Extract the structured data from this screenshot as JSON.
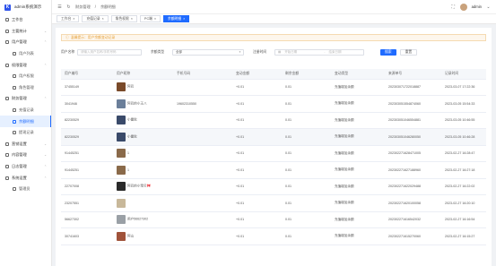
{
  "app": {
    "logo_letter": "K",
    "title": "admin系统演示"
  },
  "sidebar": {
    "items": [
      {
        "label": "工作台",
        "level": 0,
        "active": false,
        "icon": "dashboard-icon"
      },
      {
        "label": "主要统计",
        "level": 0,
        "active": false,
        "icon": "chart-icon",
        "caret": "⌄"
      },
      {
        "label": "用户管理",
        "level": 0,
        "active": false,
        "icon": "user-icon",
        "caret": "⌃"
      },
      {
        "label": "用户列表",
        "level": 1,
        "active": false,
        "icon": "list-icon"
      },
      {
        "label": "权限管理",
        "level": 0,
        "active": false,
        "icon": "lock-icon",
        "caret": "⌃"
      },
      {
        "label": "用户权限",
        "level": 1,
        "active": false,
        "icon": "key-icon"
      },
      {
        "label": "角色管理",
        "level": 1,
        "active": false,
        "icon": "role-icon"
      },
      {
        "label": "财务管理",
        "level": 0,
        "active": false,
        "icon": "wallet-icon",
        "caret": "⌃"
      },
      {
        "label": "充值记录",
        "level": 1,
        "active": false,
        "icon": "recharge-icon"
      },
      {
        "label": "余额明细",
        "level": 1,
        "active": true,
        "icon": "balance-icon"
      },
      {
        "label": "提现记录",
        "level": 1,
        "active": false,
        "icon": "withdraw-icon"
      },
      {
        "label": "营销设置",
        "level": 0,
        "active": false,
        "icon": "megaphone-icon",
        "caret": "⌄"
      },
      {
        "label": "内容管理",
        "level": 0,
        "active": false,
        "icon": "document-icon",
        "caret": "⌄"
      },
      {
        "label": "日志管理",
        "level": 0,
        "active": false,
        "icon": "log-icon",
        "caret": "⌃"
      },
      {
        "label": "系统设置",
        "level": 0,
        "active": false,
        "icon": "gear-icon",
        "caret": "⌃"
      },
      {
        "label": "管理员",
        "level": 1,
        "active": false,
        "icon": "admin-icon"
      }
    ]
  },
  "topbar": {
    "breadcrumb": [
      "财务管理",
      "/",
      "余额明细"
    ],
    "username": "admin",
    "fullscreen_icon": "⛶",
    "refresh_icon": "↻"
  },
  "tabs": [
    {
      "label": "工作台",
      "active": false
    },
    {
      "label": "充值记录",
      "active": false
    },
    {
      "label": "角色权限",
      "active": false
    },
    {
      "label": "PC端",
      "active": false
    },
    {
      "label": "余额明细",
      "active": true
    }
  ],
  "notice": {
    "icon": "ⓘ",
    "text": "温馨提示：用户余额变动记录"
  },
  "filter": {
    "user_label": "用户名称",
    "user_placeholder": "请输入用户名称/手机号码",
    "type_label": "余额类型",
    "type_value": "全部",
    "time_label": "注册时间",
    "start_placeholder": "开始日期",
    "end_placeholder": "结束日期",
    "search_label": "搜索",
    "reset_label": "重置"
  },
  "table": {
    "columns": [
      "用户编号",
      "用户昵称",
      "手机号码",
      "变动金额",
      "剩余金额",
      "变动类型",
      "来源单号",
      "记录时间"
    ],
    "rows": [
      {
        "id": "37455149",
        "nick": "阿巴",
        "phone": "",
        "change": "+0.01",
        "remain": "0.01",
        "type": "充值增加余额",
        "order": "202303071722018887",
        "time": "2023-03-07 17:22:36",
        "color": "#7a4a2a"
      },
      {
        "id": "3041946",
        "nick": "阿巴的小王八",
        "phone": "19602310550",
        "change": "+0.01",
        "remain": "0.01",
        "type": "充值增加余额",
        "order": "202303051554874060",
        "time": "2023-03-05 15:54:33",
        "color": "#6b7f9a"
      },
      {
        "id": "82230529",
        "nick": "小雷驼",
        "phone": "",
        "change": "+0.01",
        "remain": "0.01",
        "type": "充值增加余额",
        "order": "202303051046554881",
        "time": "2023-03-05 10:46:55",
        "color": "#3a4a6a"
      },
      {
        "id": "82230529",
        "nick": "小雷驼",
        "phone": "",
        "change": "+0.01",
        "remain": "0.01",
        "type": "充值增加余额",
        "order": "202303051046280050",
        "time": "2023-03-05 10:46:28",
        "color": "#3a4a6a"
      },
      {
        "id": "91445251",
        "nick": "1",
        "phone": "",
        "change": "+0.01",
        "remain": "0.01",
        "type": "充值增加余额",
        "order": "202302271628471005",
        "time": "2023-02-27 16:28:47",
        "color": "#8a6a4a"
      },
      {
        "id": "91445251",
        "nick": "1",
        "phone": "",
        "change": "+0.01",
        "remain": "0.01",
        "type": "充值增加余额",
        "order": "202302271627188960",
        "time": "2023-02-27 16:27:18",
        "color": "#8a6a4a"
      },
      {
        "id": "22707008",
        "nick": "阿巴的小宝贝🎀",
        "phone": "",
        "change": "+0.01",
        "remain": "0.01",
        "type": "充值增加余额",
        "order": "202302271622029488",
        "time": "2023-02-27 16:22:02",
        "color": "#2a2a2a"
      },
      {
        "id": "23207551",
        "nick": "",
        "phone": "",
        "change": "+0.01",
        "remain": "0.01",
        "type": "充值增加余额",
        "order": "202302271620100058",
        "time": "2023-02-27 16:20:10",
        "color": "#c8b89a"
      },
      {
        "id": "56627302",
        "nick": "用户56627302",
        "phone": "",
        "change": "+0.01",
        "remain": "0.01",
        "type": "充值增加余额",
        "order": "202302271616542032",
        "time": "2023-02-27 16:16:54",
        "color": "#9aa0a6"
      },
      {
        "id": "30741603",
        "nick": "阿山",
        "phone": "",
        "change": "+0.01",
        "remain": "0.01",
        "type": "充值增加余额",
        "order": "202302271615270060",
        "time": "2023-02-27 16:15:27",
        "color": "#a0523a"
      }
    ]
  }
}
